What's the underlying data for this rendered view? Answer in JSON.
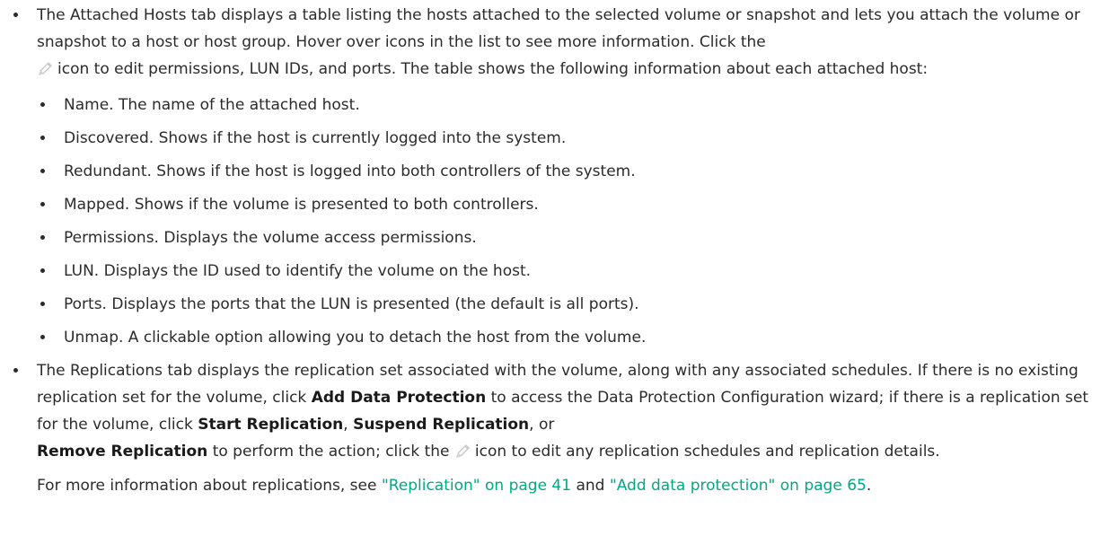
{
  "colors": {
    "text": "#2b2b2b",
    "link": "#01a982",
    "pencil_icon": "#c8c8c8"
  },
  "attached_hosts": {
    "intro_1": "The Attached Hosts tab displays a table listing the hosts attached to the selected volume or snapshot and lets you attach the volume or snapshot to a host or host group. Hover over icons in the list to see more information. Click the",
    "intro_2": "icon to edit permissions, LUN IDs, and ports. The table shows the following information about each attached host:",
    "items": [
      "Name. The name of the attached host.",
      "Discovered. Shows if the host is currently logged into the system.",
      "Redundant. Shows if the host is logged into both controllers of the system.",
      "Mapped. Shows if the volume is presented to both controllers.",
      "Permissions. Displays the volume access permissions.",
      "LUN. Displays the ID used to identify the volume on the host.",
      "Ports. Displays the ports that the LUN is presented (the default is all ports).",
      "Unmap. A clickable option allowing you to detach the host from the volume."
    ]
  },
  "replications": {
    "text_1": "The Replications tab displays the replication set associated with the volume, along with any associated schedules. If there is no existing replication set for the volume, click",
    "bold_add": "Add Data Protection",
    "text_2": "to access the Data Protection Configuration wizard; if there is a replication set for the volume, click",
    "bold_start": "Start Replication",
    "comma_1": ",",
    "bold_suspend": "Suspend Replication",
    "text_or": ", or",
    "bold_remove": "Remove Replication",
    "text_3": "to perform the action; click the",
    "text_4": "icon to edit any replication schedules and replication details.",
    "note_prefix": "For more information about replications, see",
    "link_1": "\"Replication\" on page 41",
    "note_and": "and",
    "link_2": "\"Add data protection\" on page 65",
    "note_end": "."
  }
}
